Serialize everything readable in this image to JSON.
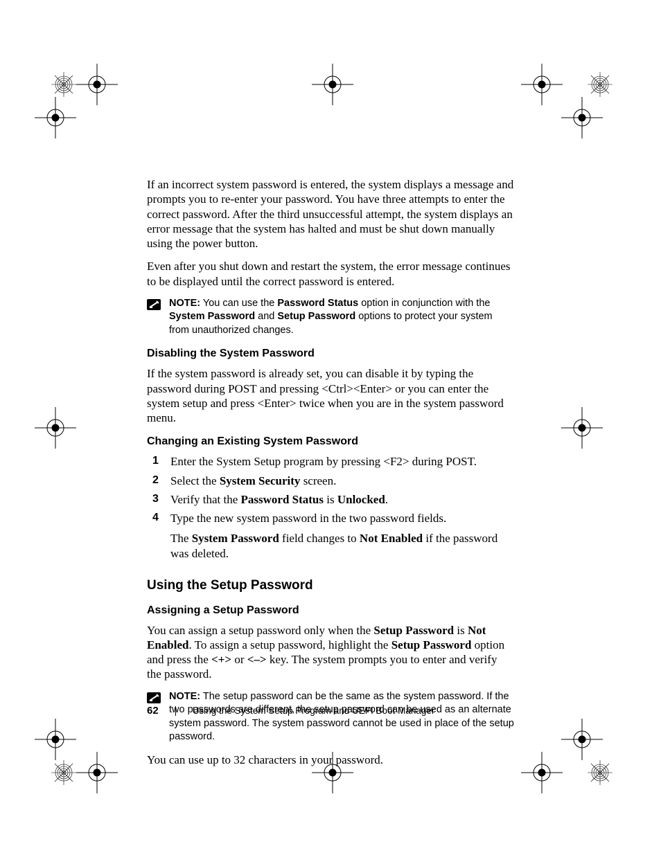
{
  "paragraphs": {
    "p1": "If an incorrect system password is entered, the system displays a message and prompts you to re-enter your password. You have three attempts to enter the correct password. After the third unsuccessful attempt, the system displays an error message that the system has halted and must be shut down manually using the power button.",
    "p2": "Even after you shut down and restart the system, the error message continues to be displayed until the correct password is entered."
  },
  "note1": {
    "label": "NOTE:",
    "t1": " You can use the ",
    "b1": "Password Status",
    "t2": " option in conjunction with the ",
    "b2": "System Password",
    "t3": " and ",
    "b3": "Setup Password",
    "t4": " options to protect your system from unauthorized changes."
  },
  "sub1": "Disabling the System Password",
  "p3": "If the system password is already set, you can disable it by typing the password during POST and pressing <Ctrl><Enter> or you can enter the system setup and press <Enter> twice when you are in the system password menu.",
  "sub2": "Changing an Existing System Password",
  "steps": {
    "s1": "Enter the System Setup program by pressing <F2> during POST.",
    "s2a": "Select the ",
    "s2b": "System Security",
    "s2c": " screen.",
    "s3a": "Verify that the ",
    "s3b": "Password Status",
    "s3c": " is ",
    "s3d": "Unlocked",
    "s3e": ".",
    "s4": "Type the new system password in the two password fields."
  },
  "p4": {
    "t1": "The ",
    "b1": "System Password",
    "t2": " field changes to ",
    "b2": "Not Enabled",
    "t3": " if the password was deleted."
  },
  "h2": "Using the Setup Password",
  "sub3": "Assigning a Setup Password",
  "p5": {
    "t1": "You can assign a setup password only when the ",
    "b1": "Setup Password",
    "t2": " is ",
    "b2": "Not Enabled",
    "t3": ". To assign a setup password, highlight the ",
    "b3": "Setup Password",
    "t4": " option and press the ",
    "b4": "<+>",
    "t5": " or ",
    "b5": "<–>",
    "t6": " key. The system prompts you to enter and verify the password."
  },
  "note2": {
    "label": "NOTE:",
    "text": " The setup password can be the same as the system password. If the two passwords are different, the setup password can be used as an alternate system password. The system password cannot be used in place of the setup password."
  },
  "p6": "You can use up to 32 characters in your password.",
  "footer": {
    "page": "62",
    "title": "Using the System Setup Program and UEFI Boot Manager"
  }
}
